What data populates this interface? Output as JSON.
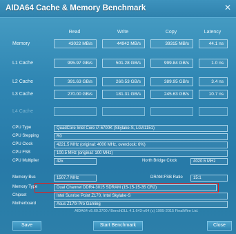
{
  "window": {
    "title": "AIDA64 Cache & Memory Benchmark",
    "close_glyph": "✕"
  },
  "columns": [
    "Read",
    "Write",
    "Copy",
    "Latency"
  ],
  "bench_rows": [
    {
      "label": "Memory",
      "values": [
        "43022 MB/s",
        "44942 MB/s",
        "39315 MB/s",
        "44.1 ns"
      ]
    },
    {
      "label": "L1 Cache",
      "values": [
        "995.97 GB/s",
        "501.28 GB/s",
        "999.84 GB/s",
        "1.0 ns"
      ]
    },
    {
      "label": "L2 Cache",
      "values": [
        "391.63 GB/s",
        "260.53 GB/s",
        "389.95 GB/s",
        "3.4 ns"
      ]
    },
    {
      "label": "L3 Cache",
      "values": [
        "270.00 GB/s",
        "181.31 GB/s",
        "245.63 GB/s",
        "10.7 ns"
      ]
    },
    {
      "label": "L4 Cache",
      "values": [
        "",
        "",
        "",
        ""
      ]
    }
  ],
  "info": {
    "cpu_type": {
      "label": "CPU Type",
      "value": "QuadCore Intel Core i7-6700K (Skylake-S, LGA1151)"
    },
    "cpu_stepping": {
      "label": "CPU Stepping",
      "value": "R0"
    },
    "cpu_clock": {
      "label": "CPU Clock",
      "value": "4221.5 MHz (original: 4000 MHz, overclock: 6%)"
    },
    "cpu_fsb": {
      "label": "CPU FSB",
      "value": "100.5 MHz (original: 100 MHz)"
    },
    "cpu_multiplier": {
      "label": "CPU Multiplier",
      "value": "42x"
    },
    "north_bridge_clock": {
      "label": "North Bridge Clock",
      "value": "4020.5 MHz"
    },
    "memory_bus": {
      "label": "Memory Bus",
      "value": "1507.7 MHz"
    },
    "dram_fsb_ratio": {
      "label": "DRAM:FSB Ratio",
      "value": "15:1"
    },
    "memory_type": {
      "label": "Memory Type",
      "value": "Dual Channel DDR4-3015 SDRAM (15-15-15-35 CR2)"
    },
    "chipset": {
      "label": "Chipset",
      "value": "Intel Sunrise Point Z170, Intel Skylake-S"
    },
    "motherboard": {
      "label": "Motherboard",
      "value": "Asus Z170i Pro Gaming"
    }
  },
  "footer": {
    "version_text": "AIDA64 v5.60.3700 / BenchDLL 4.1.643-x64  (c) 1995-2015 FinalWire Ltd.",
    "save_label": "Save",
    "start_label": "Start Benchmark",
    "close_label": "Close"
  },
  "colors": {
    "highlight_border": "#e02020",
    "window_bg": "#2f86b3"
  }
}
